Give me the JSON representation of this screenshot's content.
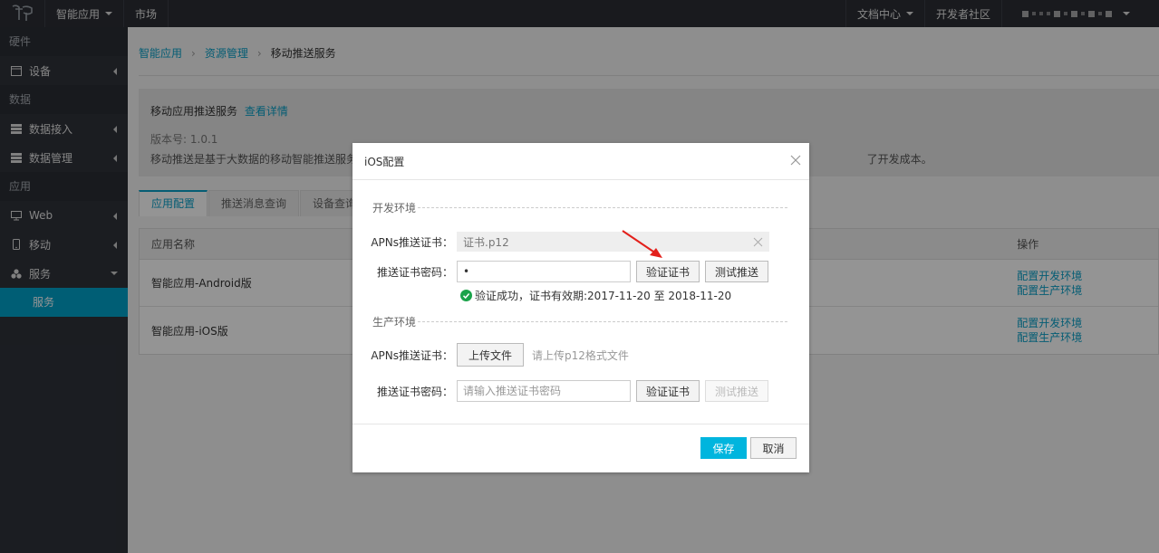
{
  "topbar": {
    "app_menu": "智能应用",
    "market": "市场",
    "docs": "文档中心",
    "community": "开发者社区"
  },
  "sidebar": {
    "groups": [
      "硬件",
      "数据",
      "应用"
    ],
    "items": {
      "device": "设备",
      "data_access": "数据接入",
      "data_manage": "数据管理",
      "web": "Web",
      "mobile": "移动",
      "service": "服务",
      "service_sub": "服务"
    }
  },
  "breadcrumb": {
    "level1": "智能应用",
    "level2": "资源管理",
    "current": "移动推送服务"
  },
  "info": {
    "title": "移动应用推送服务",
    "detail_link": "查看详情",
    "version_label": "版本号:",
    "version": "1.0.1",
    "desc_left": "移动推送是基于大数据的移动智能推送服务",
    "desc_right": "了开发成本。"
  },
  "tabs": [
    "应用配置",
    "推送消息查询",
    "设备查询"
  ],
  "table": {
    "col_name": "应用名称",
    "col_op": "操作",
    "rows": [
      {
        "name": "智能应用-Android版",
        "op1": "配置开发环境",
        "op2": "配置生产环境"
      },
      {
        "name": "智能应用-iOS版",
        "op1": "配置开发环境",
        "op2": "配置生产环境"
      }
    ]
  },
  "modal": {
    "title": "iOS配置",
    "dev": {
      "section": "开发环境",
      "cert_label": "APNs推送证书：",
      "cert_file": "证书.p12",
      "pwd_label": "推送证书密码：",
      "pwd_value": "•",
      "verify": "验证证书",
      "test": "测试推送",
      "success": "验证成功，证书有效期:2017-11-20 至 2018-11-20"
    },
    "prod": {
      "section": "生产环境",
      "cert_label": "APNs推送证书：",
      "upload": "上传文件",
      "upload_hint": "请上传p12格式文件",
      "pwd_label": "推送证书密码：",
      "pwd_placeholder": "请输入推送证书密码",
      "verify": "验证证书",
      "test": "测试推送"
    },
    "save": "保存",
    "cancel": "取消"
  },
  "colors": {
    "accent": "#00a2ca",
    "primary_button": "#00b5de",
    "success": "#1aa34a",
    "annotation_arrow": "#e3201b"
  }
}
